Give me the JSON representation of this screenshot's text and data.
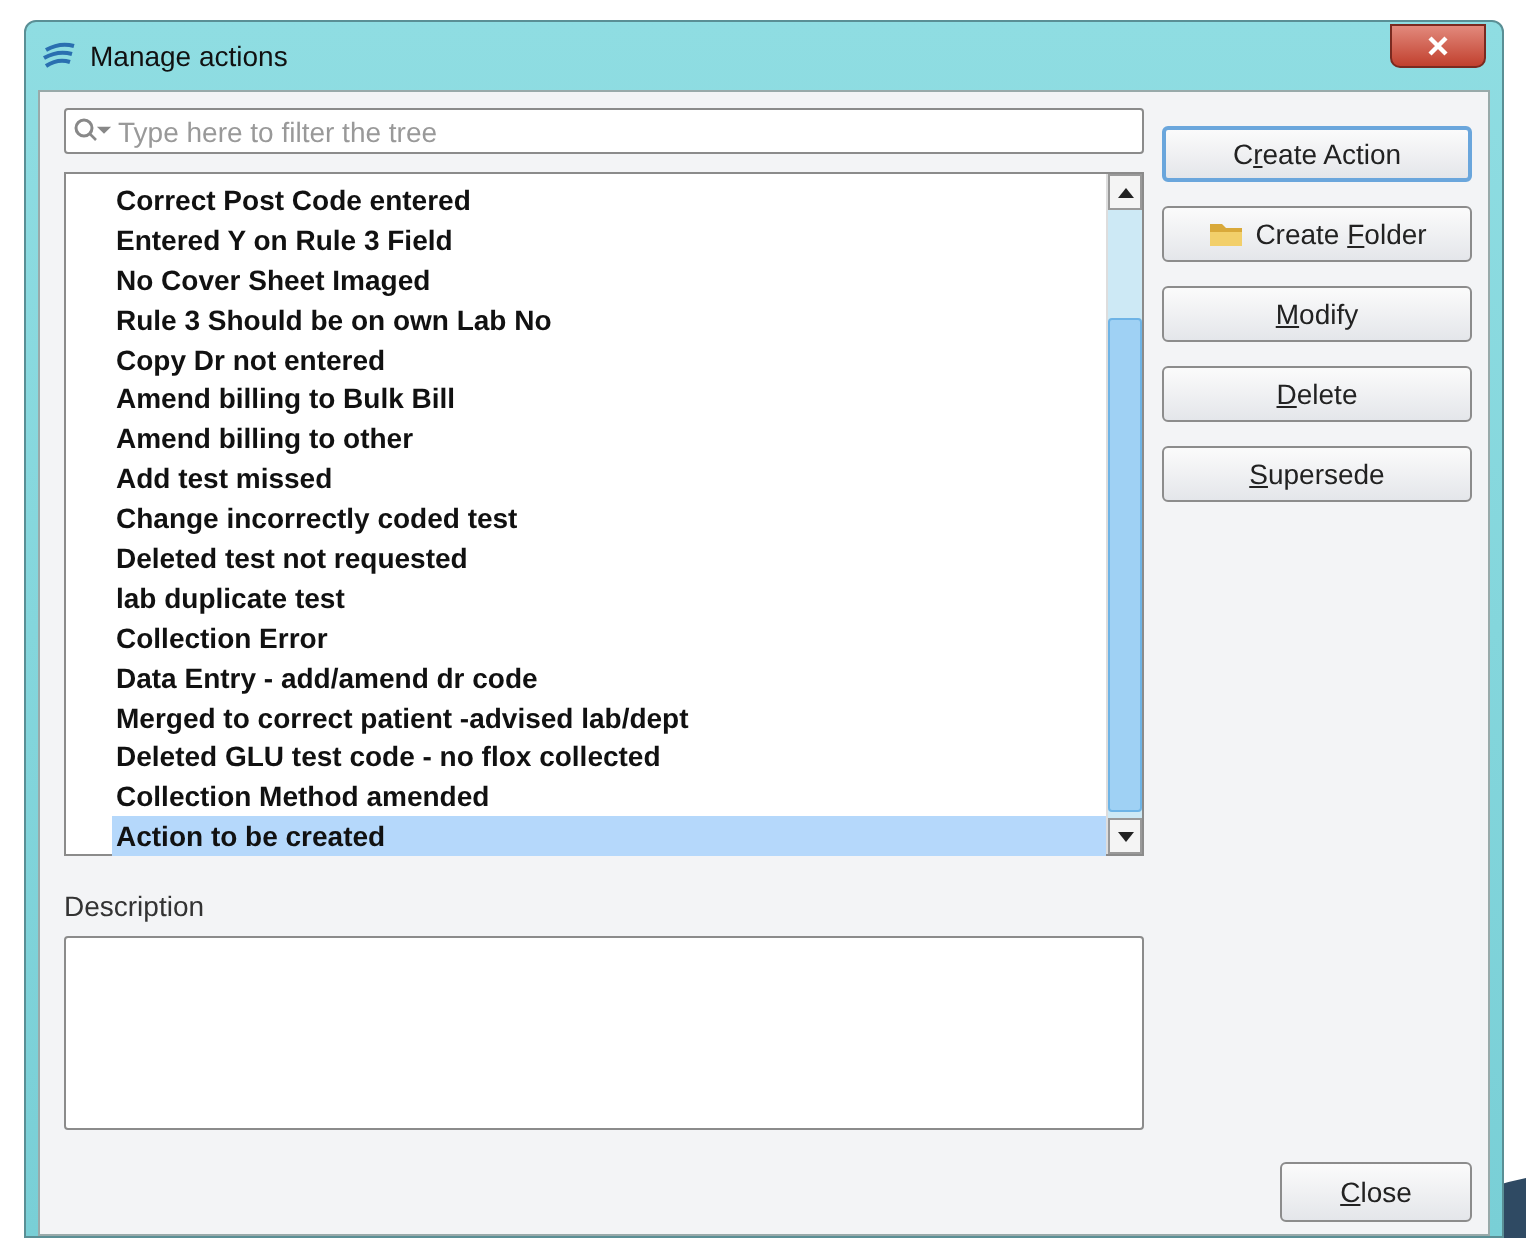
{
  "window": {
    "title": "Manage actions"
  },
  "filter": {
    "placeholder": "Type here to filter the tree"
  },
  "tree": {
    "items": [
      {
        "label": "Correct Post Code entered",
        "selected": false
      },
      {
        "label": "Entered Y on Rule 3 Field",
        "selected": false
      },
      {
        "label": "No Cover Sheet Imaged",
        "selected": false
      },
      {
        "label": "Rule 3 Should be on own Lab No",
        "selected": false
      },
      {
        "label": "Copy Dr not entered",
        "selected": false
      },
      {
        "label": "Amend billing to Bulk Bill",
        "selected": false
      },
      {
        "label": "Amend billing to other",
        "selected": false
      },
      {
        "label": "Add test missed",
        "selected": false
      },
      {
        "label": "Change  incorrectly coded test",
        "selected": false
      },
      {
        "label": "Deleted  test not requested",
        "selected": false
      },
      {
        "label": "lab duplicate test",
        "selected": false
      },
      {
        "label": "Collection Error",
        "selected": false
      },
      {
        "label": "Data Entry - add/amend dr code",
        "selected": false
      },
      {
        "label": "Merged to correct patient -advised lab/dept",
        "selected": false
      },
      {
        "label": "Deleted GLU test code - no flox collected",
        "selected": false
      },
      {
        "label": "Collection Method amended",
        "selected": false
      },
      {
        "label": "Action to be created",
        "selected": true
      }
    ]
  },
  "buttons": [
    {
      "kind": "plain",
      "text_before": "C",
      "access_key": "r",
      "text_after": "eate Action",
      "focused": true
    },
    {
      "kind": "folder",
      "text_before": "Create ",
      "access_key": "F",
      "text_after": "older",
      "focused": false
    },
    {
      "kind": "plain",
      "access_key": "M",
      "text_after": "odify",
      "focused": false
    },
    {
      "kind": "plain",
      "access_key": "D",
      "text_after": "elete",
      "focused": false
    },
    {
      "kind": "plain",
      "access_key": "S",
      "text_after": "upersede",
      "focused": false
    }
  ],
  "description": {
    "label": "Description"
  },
  "close_button": {
    "access_key": "C",
    "text_after": "lose"
  }
}
